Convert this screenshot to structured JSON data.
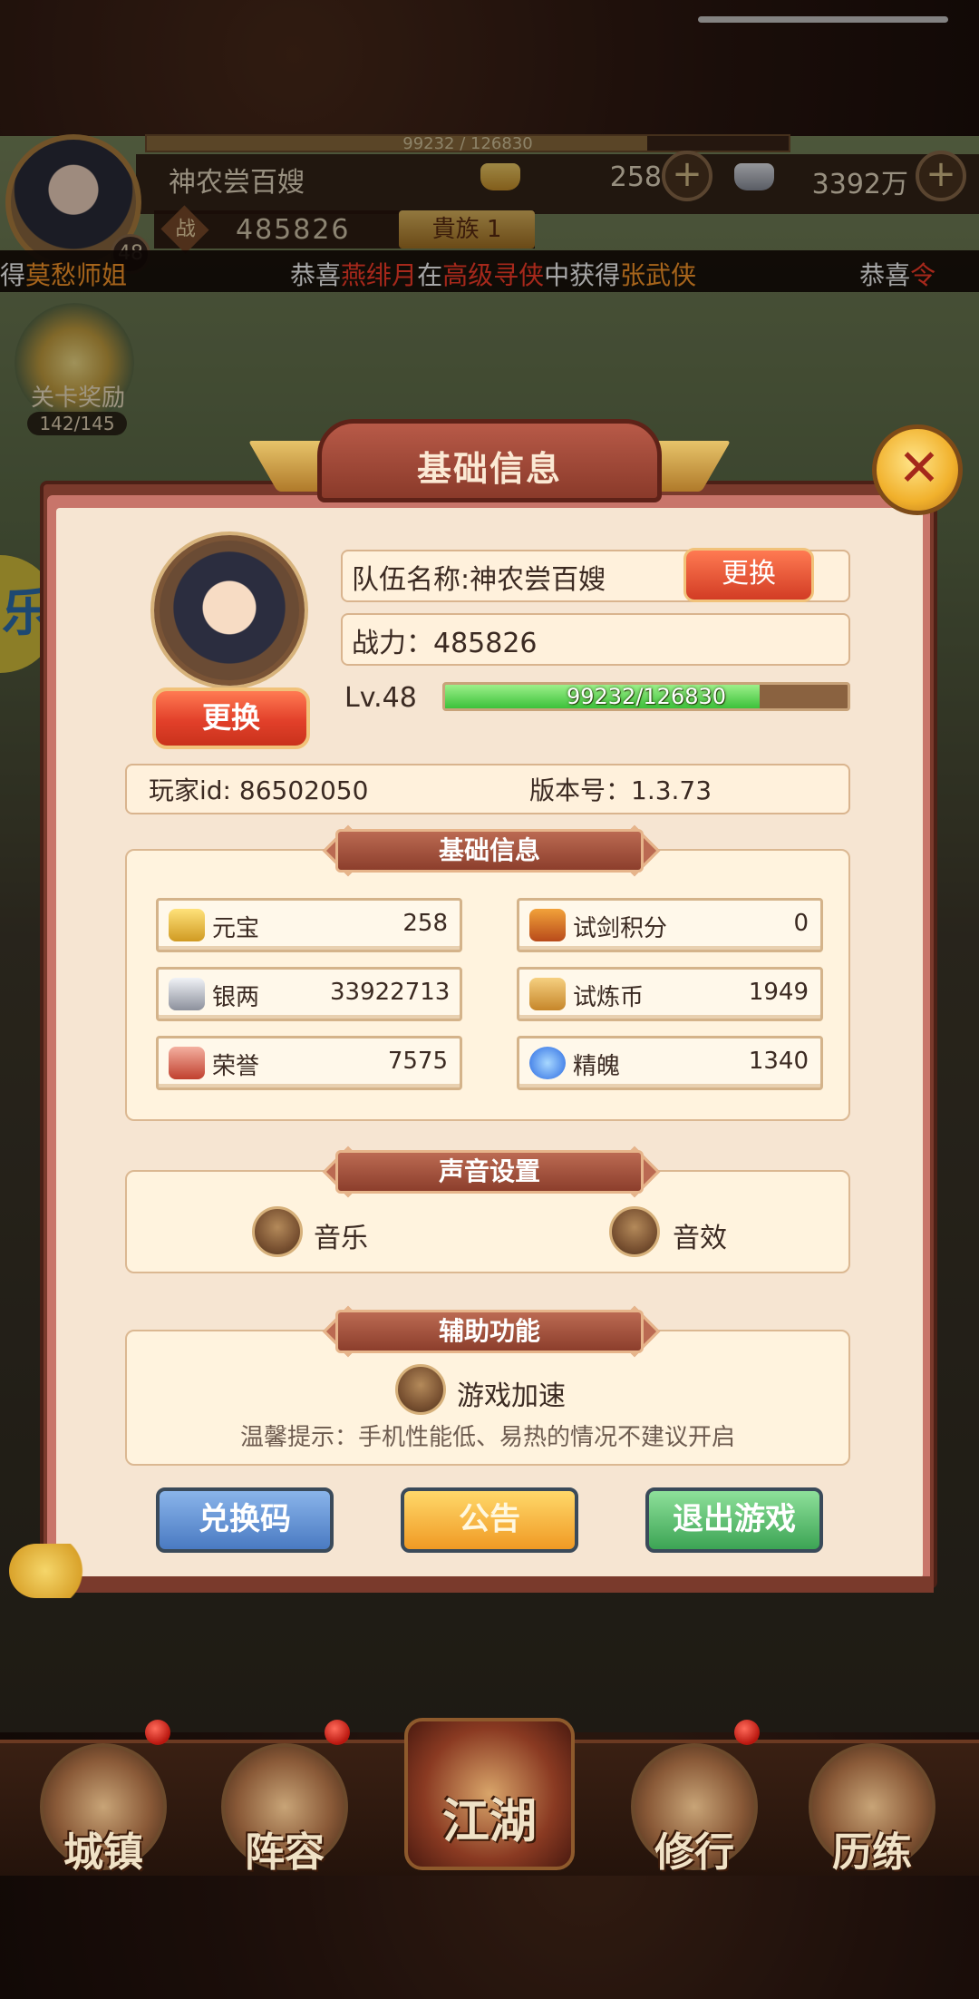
{
  "hud": {
    "exp_text": "99232 / 126830",
    "player_name": "神农尝百嫂",
    "level_badge": "48",
    "gold": "258",
    "silver": "3392万",
    "plus": "+",
    "power_icon": "战",
    "power": "485826",
    "noble": "貴族 1"
  },
  "marquee": {
    "seg1_a": "得",
    "seg1_b": "莫愁师姐",
    "seg2_a": "恭喜",
    "seg2_b": "燕绯月",
    "seg2_c": "在",
    "seg2_d": "高级寻侠",
    "seg2_e": "中获得",
    "seg2_f": "张武侠",
    "seg3_a": "恭喜",
    "seg3_b": "令"
  },
  "stage_reward": {
    "label": "关卡奖励",
    "count": "142/145"
  },
  "left_tab": "乐",
  "panel": {
    "title": "基础信息",
    "close_icon": "✕",
    "avatar_change": "更换",
    "team_label": "队伍名称:神农尝百嫂",
    "team_change": "更换",
    "power_label": "战力：485826",
    "level_label": "Lv.48",
    "exp_text": "99232/126830",
    "exp_fraction": 0.7824,
    "player_id": "玩家id: 86502050",
    "version": "版本号：1.3.73"
  },
  "resources": {
    "title": "基础信息",
    "items": [
      {
        "name": "元宝",
        "value": "258",
        "icon": "gold-ingot-icon"
      },
      {
        "name": "试剑积分",
        "value": "0",
        "icon": "sword-points-icon"
      },
      {
        "name": "银两",
        "value": "33922713",
        "icon": "silver-ingot-icon"
      },
      {
        "name": "试炼币",
        "value": "1949",
        "icon": "trial-coin-icon"
      },
      {
        "name": "荣誉",
        "value": "7575",
        "icon": "honor-icon"
      },
      {
        "name": "精魄",
        "value": "1340",
        "icon": "spirit-icon"
      }
    ]
  },
  "sound": {
    "title": "声音设置",
    "music": "音乐",
    "sfx": "音效"
  },
  "assist": {
    "title": "辅助功能",
    "speedup": "游戏加速",
    "hint": "温馨提示：手机性能低、易热的情况不建议开启"
  },
  "buttons": {
    "redeem": "兑换码",
    "notice": "公告",
    "exit": "退出游戏"
  },
  "nav": {
    "town": "城镇",
    "lineup": "阵容",
    "jianghu": "江湖",
    "practice": "修行",
    "trial": "历练"
  },
  "colors": {
    "panel_bg": "#f6e5d2",
    "panel_border": "#7a3a2c",
    "accent_red": "#e2402a",
    "exp_green": "#3cc13a"
  }
}
